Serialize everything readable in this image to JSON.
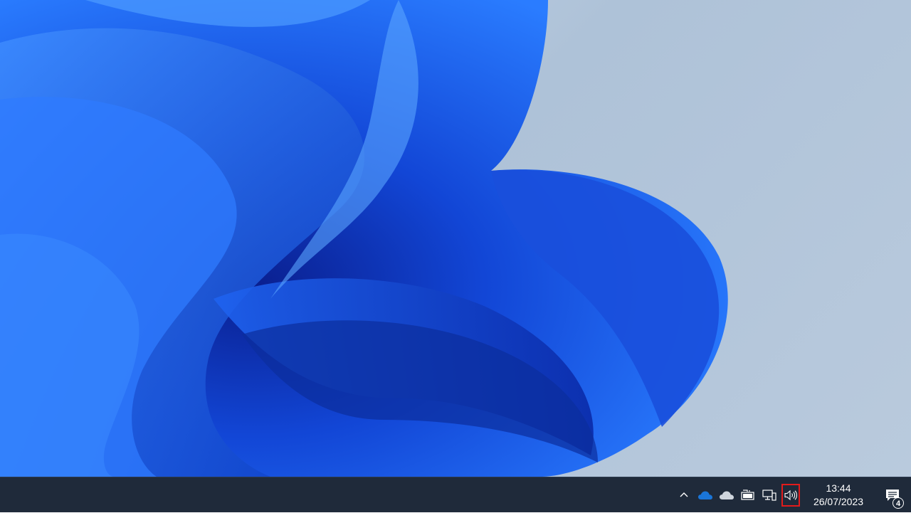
{
  "desktop": {
    "wallpaper": "windows-11-bloom-wallpaper"
  },
  "taskbar": {
    "tray": {
      "icons": [
        {
          "name": "show-hidden-icons-chevron-icon"
        },
        {
          "name": "onedrive-blue-cloud-icon",
          "color": "#1a75d8"
        },
        {
          "name": "onedrive-grey-cloud-icon",
          "color": "#cfd5dd"
        },
        {
          "name": "battery-icon"
        },
        {
          "name": "network-icon"
        },
        {
          "name": "speaker-icon",
          "highlighted": true,
          "highlight_color": "#e21b1b"
        }
      ]
    },
    "clock": {
      "time": "13:44",
      "date": "26/07/2023"
    },
    "notifications": {
      "icon": "action-center-icon",
      "count": "4"
    }
  }
}
